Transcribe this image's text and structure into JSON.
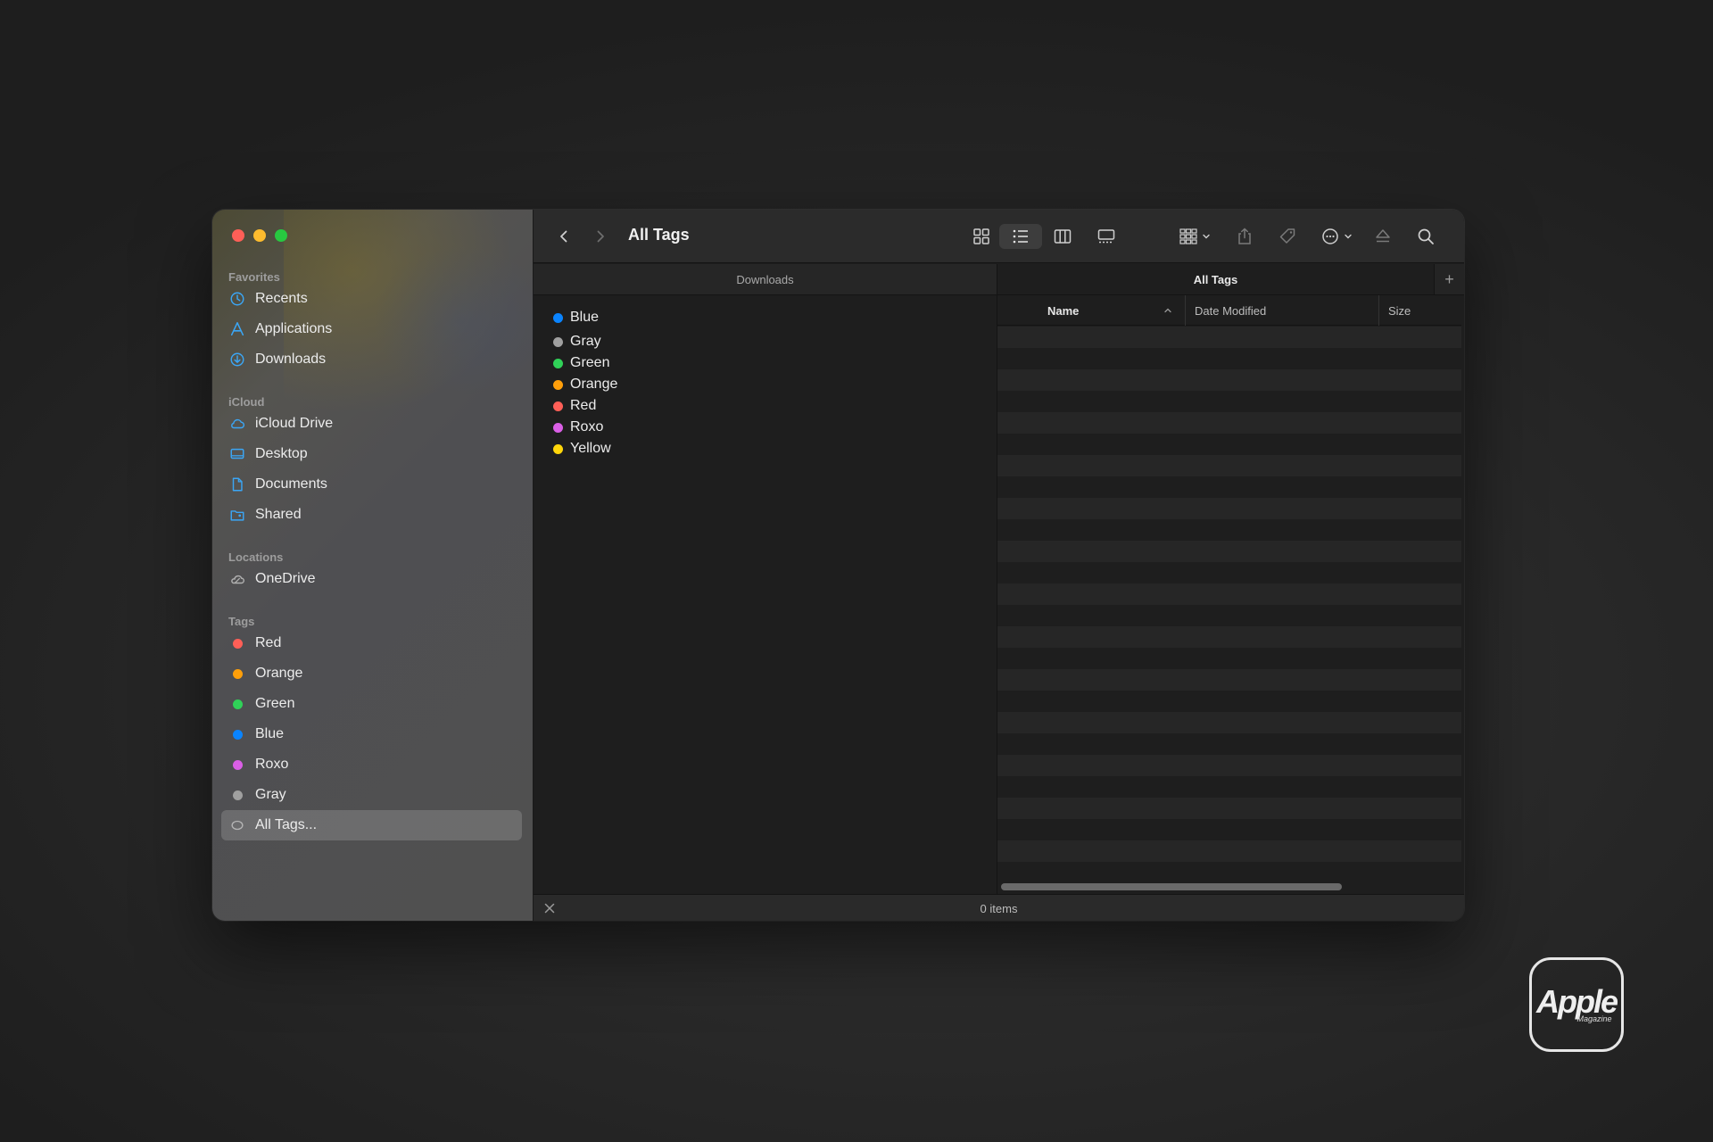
{
  "window": {
    "title": "All Tags",
    "status": "0 items"
  },
  "sidebar": {
    "sections": {
      "favorites": "Favorites",
      "icloud": "iCloud",
      "locations": "Locations",
      "tags": "Tags"
    },
    "favorites": [
      {
        "label": "Recents",
        "icon": "clock-icon"
      },
      {
        "label": "Applications",
        "icon": "applications-icon"
      },
      {
        "label": "Downloads",
        "icon": "download-icon"
      }
    ],
    "icloud": [
      {
        "label": "iCloud Drive",
        "icon": "cloud-icon"
      },
      {
        "label": "Desktop",
        "icon": "desktop-icon"
      },
      {
        "label": "Documents",
        "icon": "document-icon"
      },
      {
        "label": "Shared",
        "icon": "shared-folder-icon"
      }
    ],
    "locations": [
      {
        "label": "OneDrive",
        "icon": "onedrive-icon"
      }
    ],
    "tags": [
      {
        "label": "Red",
        "color": "#ff5f57"
      },
      {
        "label": "Orange",
        "color": "#ff9f0a"
      },
      {
        "label": "Green",
        "color": "#30d158"
      },
      {
        "label": "Blue",
        "color": "#0a84ff"
      },
      {
        "label": "Roxo",
        "color": "#da5fe6"
      },
      {
        "label": "Gray",
        "color": "#a0a0a0"
      },
      {
        "label": "All Tags...",
        "color": "",
        "selected": true
      }
    ]
  },
  "tabs": {
    "left": "Downloads",
    "right": "All Tags",
    "add": "+"
  },
  "tag_list": [
    {
      "label": "Blue",
      "color": "#0a84ff"
    },
    {
      "label": "Gray",
      "color": "#a0a0a0"
    },
    {
      "label": "Green",
      "color": "#30d158"
    },
    {
      "label": "Orange",
      "color": "#ff9f0a"
    },
    {
      "label": "Red",
      "color": "#ff5f57"
    },
    {
      "label": "Roxo",
      "color": "#da5fe6"
    },
    {
      "label": "Yellow",
      "color": "#ffd60a"
    }
  ],
  "columns": {
    "name": "Name",
    "date_modified": "Date Modified",
    "size": "Size"
  },
  "watermark": {
    "main": "Apple",
    "sub": "Magazine"
  }
}
